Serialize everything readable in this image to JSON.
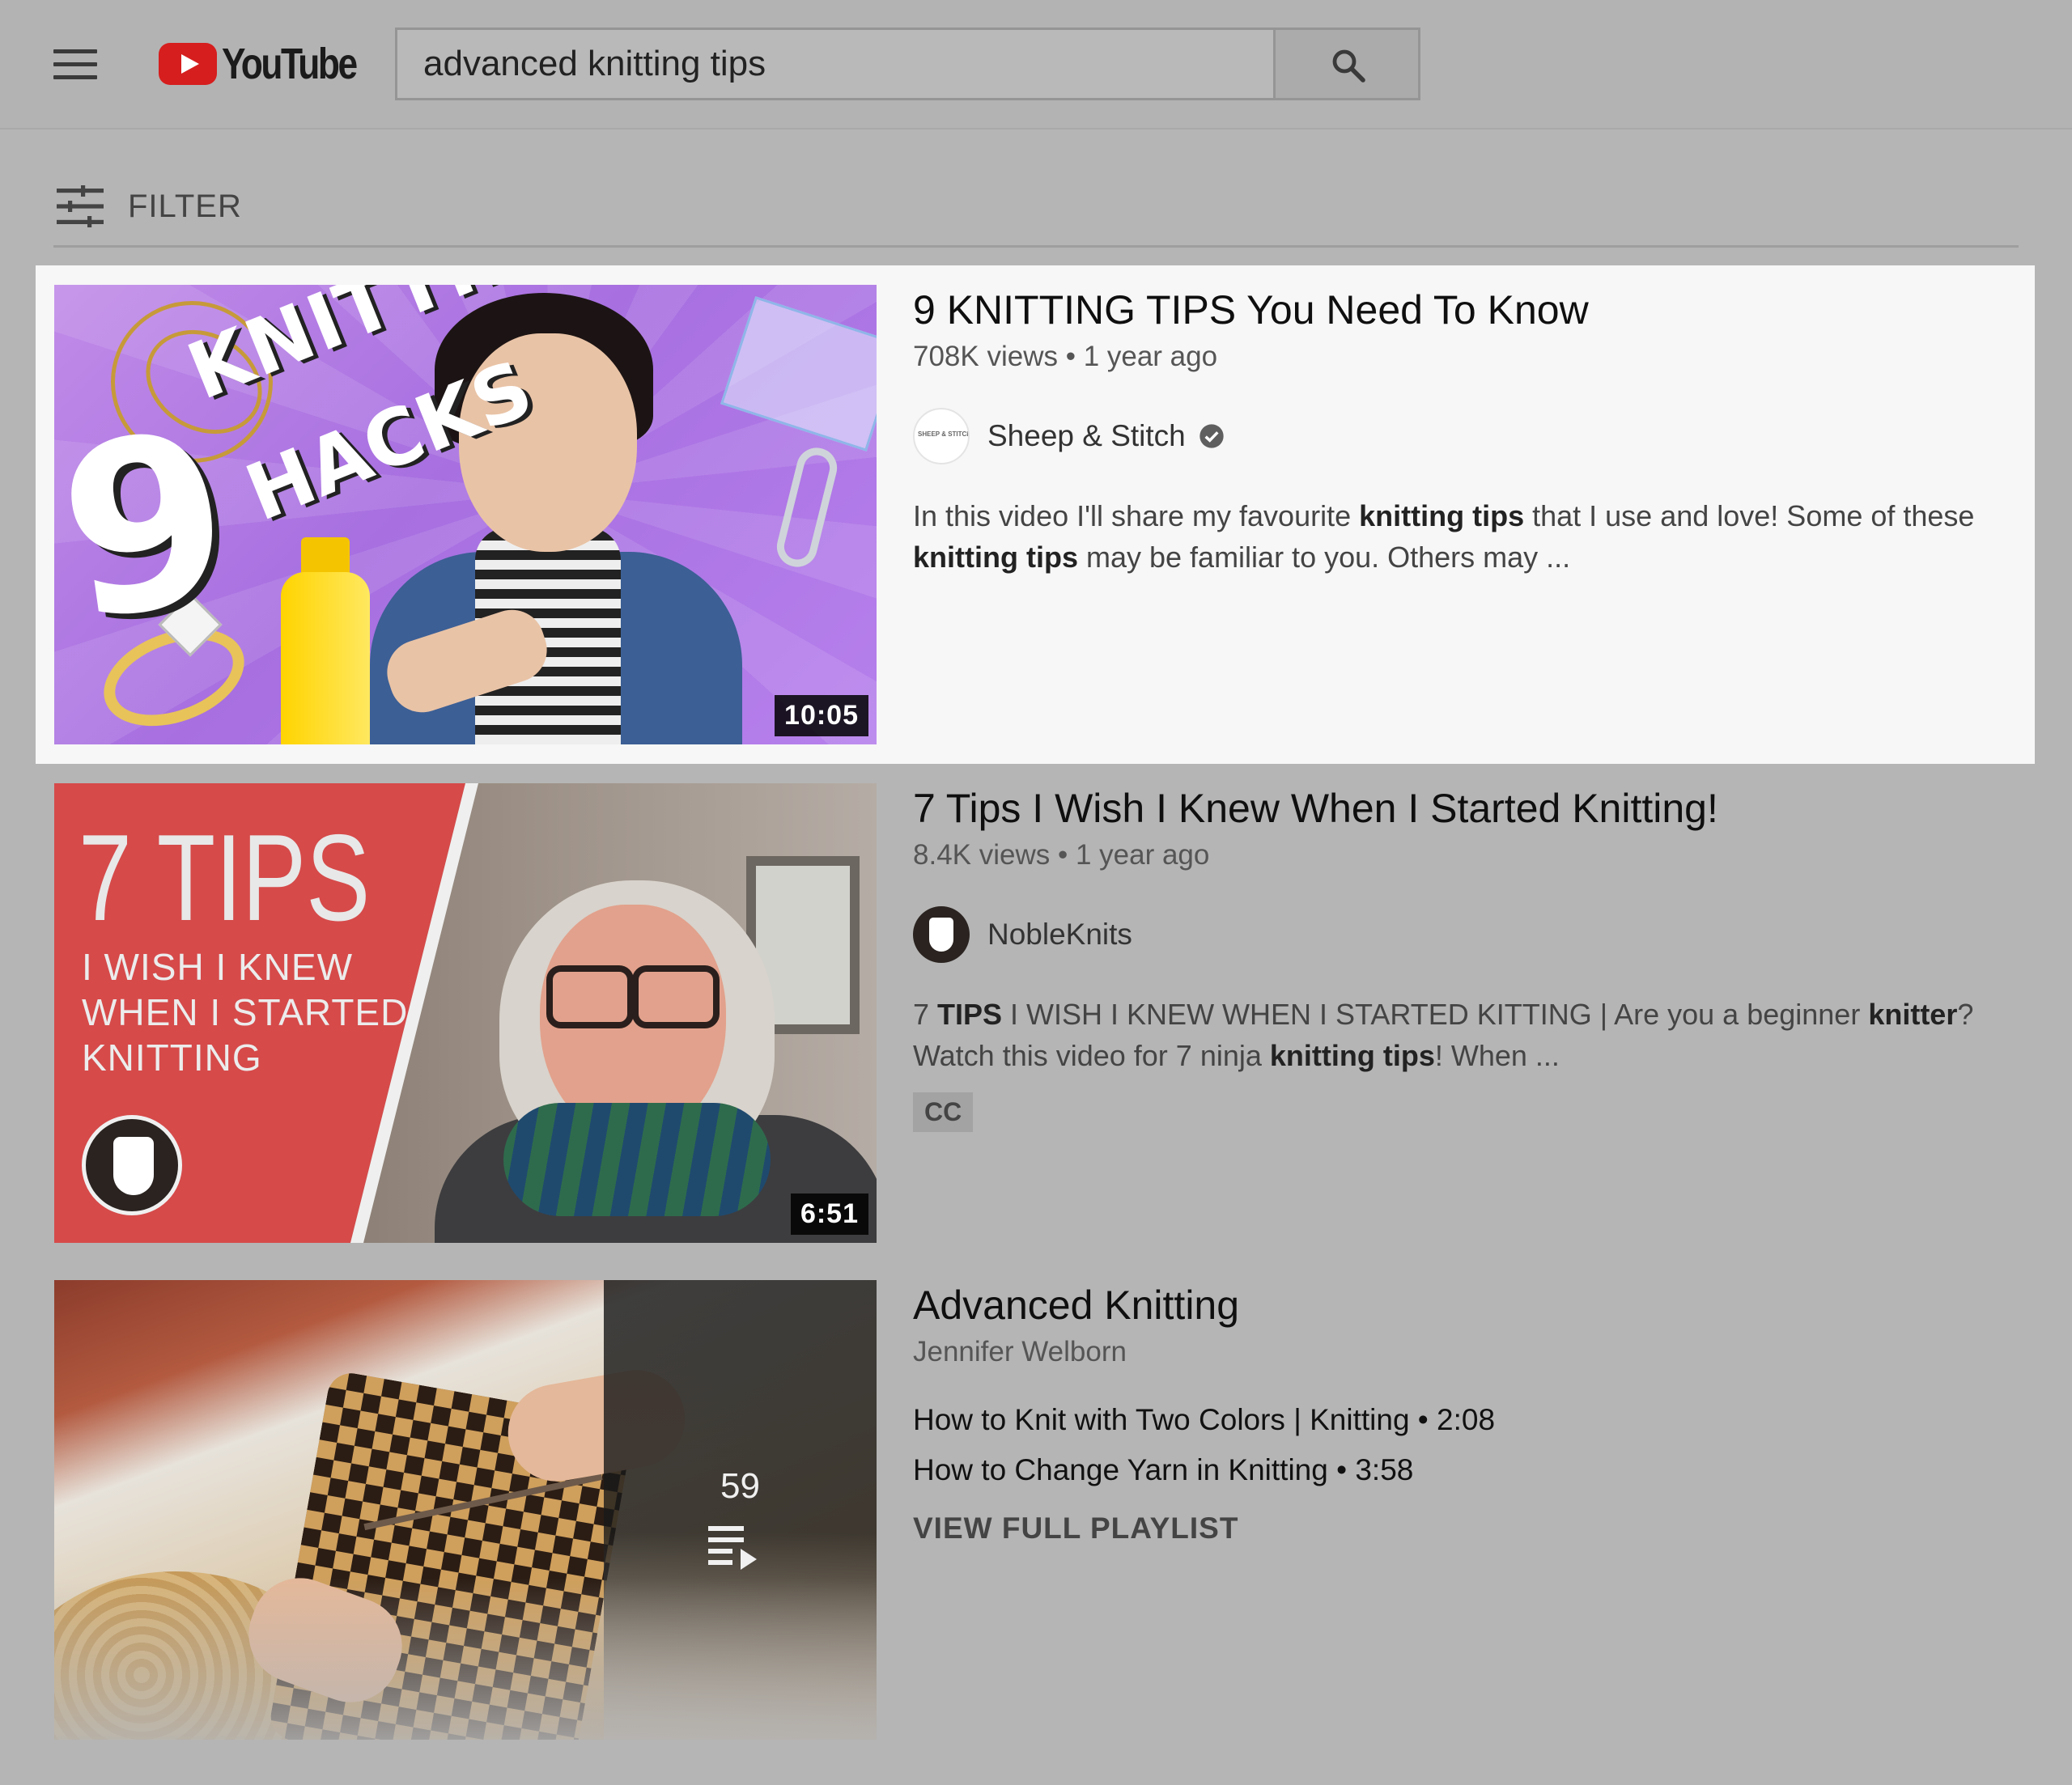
{
  "header": {
    "logo_text": "YouTube",
    "search_value": "advanced knitting tips"
  },
  "filter": {
    "label": "FILTER"
  },
  "results": [
    {
      "title": "9 KNITTING TIPS You Need To Know",
      "views": "708K views",
      "age": "1 year ago",
      "channel": "Sheep & Stitch",
      "verified": true,
      "description": {
        "p1": "In this video I'll share my favourite ",
        "b1": "knitting tips",
        "p2": " that I use and love! Some of these ",
        "b2": "knitting tips",
        "p3": " may be familiar to you. Others may ..."
      },
      "duration": "10:05",
      "thumb_text": {
        "number": "9",
        "line1": "KNITTING",
        "line2": "HACKS"
      },
      "avatar_text": "SHEEP & STITCH",
      "highlighted": true
    },
    {
      "title": "7 Tips I Wish I Knew When I Started Knitting!",
      "views": "8.4K views",
      "age": "1 year ago",
      "channel": "NobleKnits",
      "description": {
        "p1": "7 ",
        "b1": "TIPS",
        "p2": " I WISH I KNEW WHEN I STARTED KITTING | Are you a beginner ",
        "b2": "knitter",
        "p3": "? Watch this video for 7 ninja ",
        "b3": "knitting tips",
        "p4": "! When ..."
      },
      "badge": "CC",
      "duration": "6:51",
      "thumb_text": {
        "big": "7 TIPS",
        "line1": "I WISH I KNEW",
        "line2": "WHEN I STARTED",
        "line3": "KNITTING"
      }
    },
    {
      "title": "Advanced Knitting",
      "channel": "Jennifer Welborn",
      "playlist_items": [
        {
          "name": "How to Knit with Two Colors | Knitting",
          "duration": "2:08"
        },
        {
          "name": "How to Change Yarn in Knitting",
          "duration": "3:58"
        }
      ],
      "view_playlist": "VIEW FULL PLAYLIST",
      "video_count": "59"
    }
  ],
  "separator": " • ",
  "colors": {
    "page_bg": "#b5b5b5",
    "highlight_bg": "#f7f7f7",
    "youtube_red": "#d61e1e"
  }
}
